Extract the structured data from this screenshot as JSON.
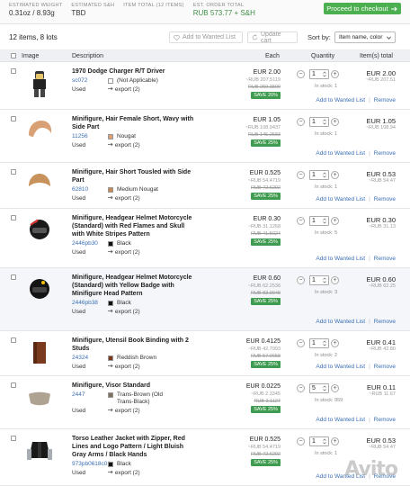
{
  "summary": {
    "weight_label": "ESTIMATED WEIGHT",
    "weight_value": "0.31oz / 8.93g",
    "sh_label": "ESTIMATED S&H",
    "sh_value": "TBD",
    "total_label": "ITEM TOTAL (12 ITEMS)",
    "total_value": "",
    "order_label": "EST. ORDER TOTAL",
    "order_value": "RUB 573.77 + S&H",
    "checkout_label": "Proceed to checkout"
  },
  "toolbar": {
    "count": "12 items, 8 lots",
    "wanted_label": "Add to Wanted List",
    "update_label": "Update cart",
    "sort_label": "Sort by:",
    "sort_value": "Item name, color"
  },
  "columns": {
    "image": "Image",
    "description": "Description",
    "each": "Each",
    "quantity": "Quantity",
    "items": "Item(s) total"
  },
  "common": {
    "used": "Used",
    "export": "export (2)",
    "add_wanted": "Add to Wanted List",
    "remove": "Remove",
    "sep": "|"
  },
  "rows": [
    {
      "name": "1970 Dodge Charger R/T Driver",
      "number": "sc072",
      "color": "(Not Applicable)",
      "price": "EUR 2.00",
      "price_rub": "~RUB 207.5119",
      "orig": "RUB 259.3899",
      "save": "SAVE 20%",
      "qty": "1",
      "stock": "In stock: 1",
      "total": "EUR 2.00",
      "total_rub": "~RUB 207.51",
      "swatch": "#ffffff"
    },
    {
      "name": "Minifigure, Hair Female Short, Wavy with Side Part",
      "number": "11256",
      "color": "Nougat",
      "price": "EUR 1.05",
      "price_rub": "~RUB 108.9437",
      "orig": "RUB 145.2583",
      "save": "SAVE 25%",
      "qty": "1",
      "stock": "In stock: 1",
      "total": "EUR 1.05",
      "total_rub": "~RUB 108.94",
      "swatch": "#d9a075"
    },
    {
      "name": "Minifigure, Hair Short Tousled with Side Part",
      "number": "62810",
      "color": "Medium Nougat",
      "price": "EUR 0.525",
      "price_rub": "~RUB 54.4719",
      "orig": "RUB 72.6292",
      "save": "SAVE 25%",
      "qty": "1",
      "stock": "In stock: 1",
      "total": "EUR 0.53",
      "total_rub": "~RUB 54.47",
      "swatch": "#c48a55"
    },
    {
      "name": "Minifigure, Headgear Helmet Motorcycle (Standard) with Red Flames and Skull with White Stripes Pattern",
      "number": "2446pb30",
      "color": "Black",
      "price": "EUR 0.30",
      "price_rub": "~RUB 31.1268",
      "orig": "RUB 41.5024",
      "save": "SAVE 25%",
      "qty": "1",
      "stock": "In stock: 5",
      "total": "EUR 0.30",
      "total_rub": "~RUB 31.13",
      "swatch": "#111111"
    },
    {
      "name": "Minifigure, Headgear Helmet Motorcycle (Standard) with Yellow Badge with Minifigure Head Pattern",
      "number": "2446pb38",
      "color": "Black",
      "price": "EUR 0.60",
      "price_rub": "~RUB 62.2536",
      "orig": "RUB 83.0048",
      "save": "SAVE 25%",
      "qty": "1",
      "stock": "In stock: 3",
      "total": "EUR 0.60",
      "total_rub": "~RUB 62.25",
      "swatch": "#111111"
    },
    {
      "name": "Minifigure, Utensil Book Binding with 2 Studs",
      "number": "24324",
      "color": "Reddish Brown",
      "price": "EUR 0.4125",
      "price_rub": "~RUB 42.7993",
      "orig": "RUB 57.0658",
      "save": "SAVE 25%",
      "qty": "1",
      "stock": "In stock: 2",
      "total": "EUR 0.41",
      "total_rub": "~RUB 42.80",
      "swatch": "#7a3a1e"
    },
    {
      "name": "Minifigure, Visor Standard",
      "number": "2447",
      "color": "Trans-Brown (Old Trans-Black)",
      "price": "EUR 0.0225",
      "price_rub": "~RUB 2.3345",
      "orig": "RUB 3.1127",
      "save": "SAVE 25%",
      "qty": "5",
      "stock": "In stock: 959",
      "total": "EUR 0.11",
      "total_rub": "~RUB 11.67",
      "swatch": "#7d6f5e"
    },
    {
      "name": "Torso Leather Jacket with Zipper, Red Lines and Logo Pattern / Light Bluish Gray Arms / Black Hands",
      "number": "973pb0618c01",
      "color": "Black",
      "price": "EUR 0.525",
      "price_rub": "~RUB 54.4719",
      "orig": "RUB 72.6292",
      "save": "SAVE 25%",
      "qty": "1",
      "stock": "In stock: 1",
      "total": "EUR 0.53",
      "total_rub": "~RUB 54.47",
      "swatch": "#111111"
    }
  ],
  "icons": {
    "checkout": "arrow-right-icon",
    "wanted": "heart-icon",
    "update": "refresh-icon",
    "sort": "chevron-down-icon",
    "spinner": "updown-icon"
  },
  "colors": {
    "accent": "#4caf50",
    "link": "#3b6fb6",
    "save_badge": "#3f9b4f",
    "header_bg": "#eef0f3"
  },
  "watermark": "Avito"
}
